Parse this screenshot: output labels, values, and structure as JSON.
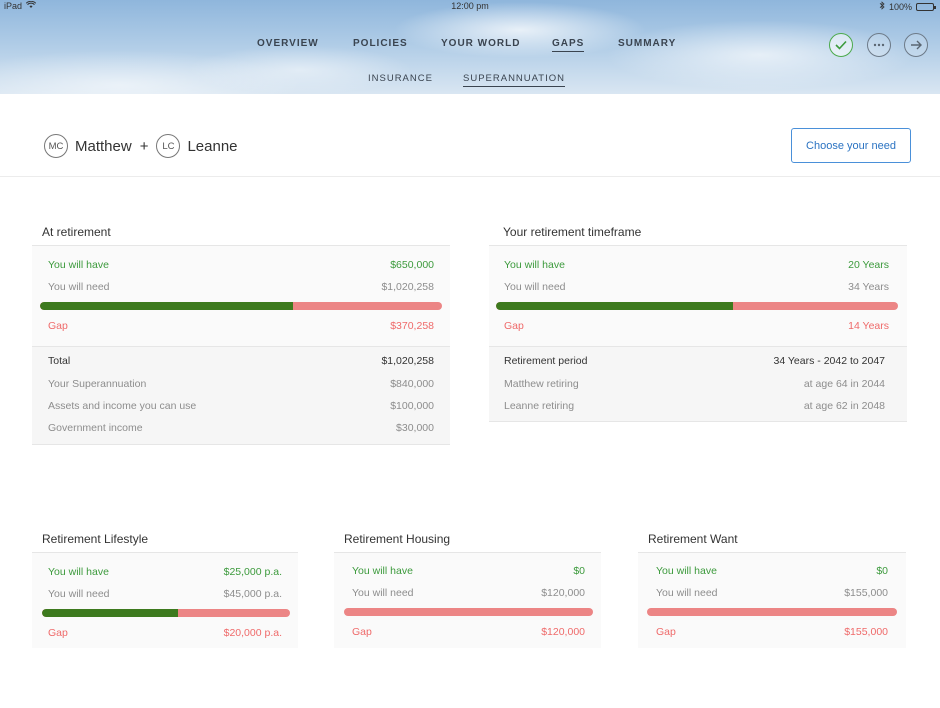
{
  "status_bar": {
    "device": "iPad",
    "time": "12:00 pm",
    "battery": "100%"
  },
  "nav": {
    "main": [
      {
        "label": "OVERVIEW",
        "active": false
      },
      {
        "label": "POLICIES",
        "active": false
      },
      {
        "label": "YOUR WORLD",
        "active": false
      },
      {
        "label": "GAPS",
        "active": true
      },
      {
        "label": "SUMMARY",
        "active": false
      }
    ],
    "sub": [
      {
        "label": "INSURANCE",
        "active": false
      },
      {
        "label": "SUPERANNUATION",
        "active": true
      }
    ]
  },
  "people": {
    "person1": {
      "initials": "MC",
      "name": "Matthew"
    },
    "separator": "+",
    "person2": {
      "initials": "LC",
      "name": "Leanne"
    }
  },
  "choose_need_label": "Choose your need",
  "at_retirement": {
    "title": "At retirement",
    "have_label": "You will have",
    "have_value": "$650,000",
    "need_label": "You will need",
    "need_value": "$1,020,258",
    "progress": 0.63,
    "gap_label": "Gap",
    "gap_value": "$370,258",
    "details": [
      {
        "label": "Total",
        "value": "$1,020,258"
      },
      {
        "label": "Your Superannuation",
        "value": "$840,000"
      },
      {
        "label": "Assets and income you can use",
        "value": "$100,000"
      },
      {
        "label": "Government income",
        "value": "$30,000"
      }
    ]
  },
  "timeframe": {
    "title": "Your retirement timeframe",
    "have_label": "You will have",
    "have_value": "20 Years",
    "need_label": "You will need",
    "need_value": "34 Years",
    "progress": 0.59,
    "gap_label": "Gap",
    "gap_value": "14 Years",
    "details": [
      {
        "label": "Retirement period",
        "value": "34 Years - 2042 to 2047"
      },
      {
        "label": "Matthew retiring",
        "value": "at age 64 in 2044"
      },
      {
        "label": "Leanne retiring",
        "value": "at age 62 in 2048"
      }
    ]
  },
  "lifestyle": {
    "title": "Retirement Lifestyle",
    "have_label": "You will have",
    "have_value": "$25,000 p.a.",
    "need_label": "You will need",
    "need_value": "$45,000 p.a.",
    "progress": 0.55,
    "gap_label": "Gap",
    "gap_value": "$20,000 p.a."
  },
  "housing": {
    "title": "Retirement Housing",
    "have_label": "You will have",
    "have_value": "$0",
    "need_label": "You will need",
    "need_value": "$120,000",
    "progress": 0,
    "gap_label": "Gap",
    "gap_value": "$120,000"
  },
  "want": {
    "title": "Retirement Want",
    "have_label": "You will have",
    "have_value": "$0",
    "need_label": "You will need",
    "need_value": "$155,000",
    "progress": 0,
    "gap_label": "Gap",
    "gap_value": "$155,000"
  },
  "colors": {
    "have": "#3c9a3c",
    "gap": "#ef6a6a",
    "bar_fill": "#3d7a1e",
    "bar_track": "#ec8585",
    "accent": "#2b73c2"
  }
}
